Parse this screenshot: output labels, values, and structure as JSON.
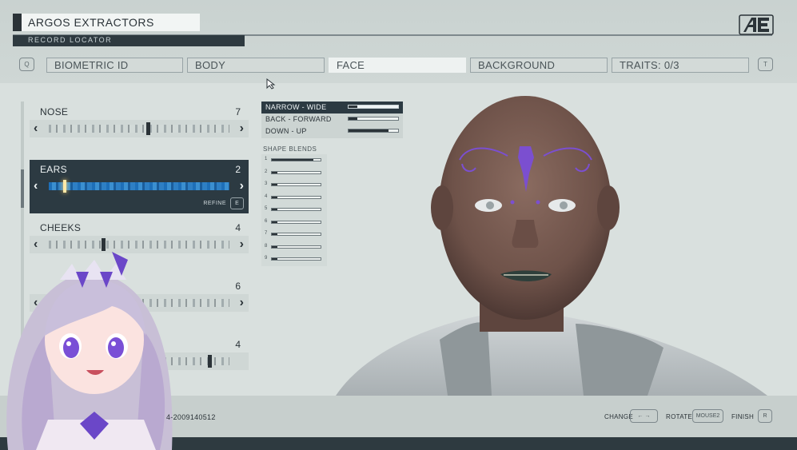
{
  "header": {
    "title": "ARGOS EXTRACTORS",
    "subtitle": "RECORD LOCATOR",
    "logo": "AE"
  },
  "nav": {
    "prev_key": "Q",
    "next_key": "T",
    "tabs": [
      "BIOMETRIC ID",
      "BODY",
      "FACE",
      "BACKGROUND",
      "TRAITS: 0/3"
    ],
    "active_tab": "FACE"
  },
  "features": [
    {
      "name": "NOSE",
      "value": "7",
      "level": 0.55
    },
    {
      "name": "EARS",
      "value": "2",
      "level": 0.08,
      "selected": true,
      "refine_label": "REFINE",
      "refine_key": "E"
    },
    {
      "name": "CHEEKS",
      "value": "4",
      "level": 0.3
    },
    {
      "name": "",
      "value": "6",
      "level": 0.45
    },
    {
      "name": "",
      "value": "4",
      "level": 0.9
    }
  ],
  "params": [
    {
      "label": "NARROW - WIDE",
      "level": 0.18,
      "active": true
    },
    {
      "label": "BACK - FORWARD",
      "level": 0.18
    },
    {
      "label": "DOWN - UP",
      "level": 0.8
    }
  ],
  "shape_blends": {
    "label": "SHAPE BLENDS",
    "items": [
      {
        "num": "1",
        "level": 0.85
      },
      {
        "num": "2",
        "level": 0.12
      },
      {
        "num": "3",
        "level": 0.12
      },
      {
        "num": "4",
        "level": 0.12
      },
      {
        "num": "5",
        "level": 0.12
      },
      {
        "num": "6",
        "level": 0.12
      },
      {
        "num": "7",
        "level": 0.12
      },
      {
        "num": "8",
        "level": 0.12
      },
      {
        "num": "9",
        "level": 0.12
      }
    ]
  },
  "footer": {
    "locator_id": "4-2009140512",
    "change_label": "CHANGE",
    "change_key": "← →",
    "rotate_label": "ROTATE",
    "rotate_key": "MOUSE2",
    "finish_label": "FINISH",
    "finish_key": "R"
  },
  "colors": {
    "accent": "#2c3a42",
    "slider_selected": "#2e7fc4",
    "tattoo": "#7b4fd0"
  }
}
